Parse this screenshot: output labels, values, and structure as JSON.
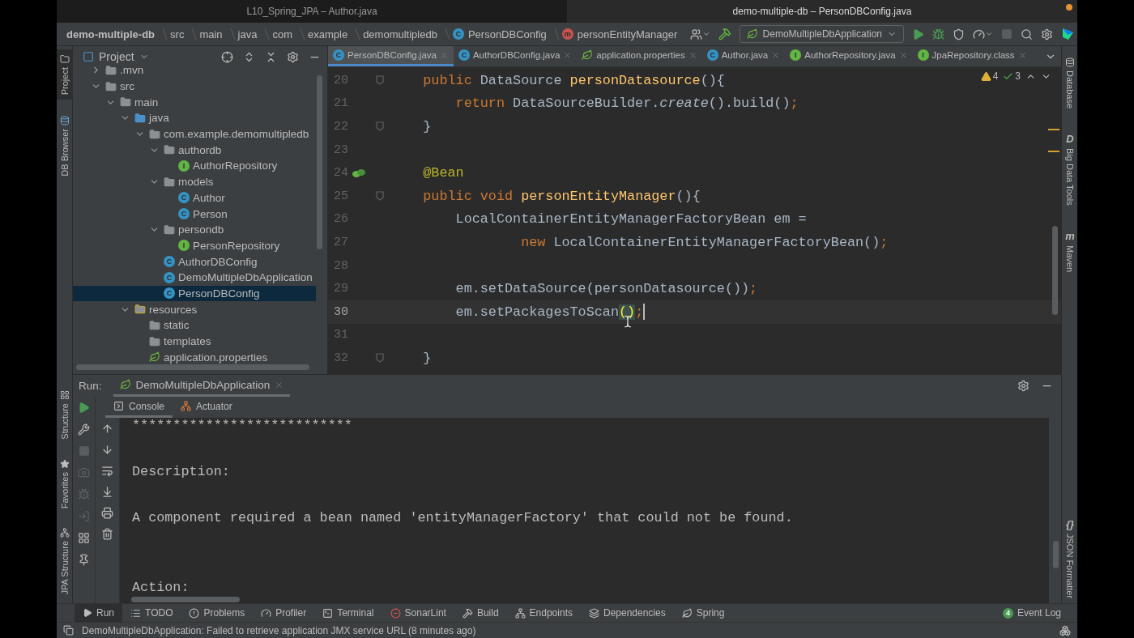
{
  "title_bar": {
    "left_title": "L10_Spring_JPA – Author.java",
    "right_title": "demo-multiple-db – PersonDBConfig.java"
  },
  "breadcrumbs": [
    {
      "label": "demo-multiple-db",
      "kind": "project"
    },
    {
      "label": "src",
      "kind": "folder"
    },
    {
      "label": "main",
      "kind": "folder"
    },
    {
      "label": "java",
      "kind": "folder"
    },
    {
      "label": "com",
      "kind": "folder"
    },
    {
      "label": "example",
      "kind": "folder"
    },
    {
      "label": "demomultipledb",
      "kind": "folder"
    },
    {
      "label": "PersonDBConfig",
      "kind": "class",
      "badge": "C"
    },
    {
      "label": "personEntityManager",
      "kind": "method",
      "badge": "m"
    }
  ],
  "run_configuration": "DemoMultipleDbApplication",
  "left_stripe_top": [
    {
      "label": "Project",
      "selected": true
    },
    {
      "label": "DB Browser",
      "selected": false
    }
  ],
  "left_stripe_bottom": [
    {
      "label": "Structure",
      "selected": false
    },
    {
      "label": "Favorites",
      "selected": false
    },
    {
      "label": "JPA Structure",
      "selected": false
    }
  ],
  "right_stripe_top": [
    {
      "label": "Database",
      "kind": "database"
    },
    {
      "label": "Big Data Tools",
      "kind": "glyph",
      "glyph": "D"
    },
    {
      "label": "Maven",
      "kind": "glyph",
      "glyph": "m"
    }
  ],
  "right_stripe_bottom": [
    {
      "label": "JSON Formatter",
      "kind": "glyph",
      "glyph": "{}"
    }
  ],
  "project_panel": {
    "title": "Project",
    "tree": [
      {
        "label": ".mvn",
        "kind": "folder",
        "expanded": false,
        "selected": false
      },
      {
        "label": "src",
        "kind": "folder",
        "expanded": true,
        "selected": false,
        "children": [
          {
            "label": "main",
            "kind": "folder",
            "expanded": true,
            "selected": false,
            "children": [
              {
                "label": "java",
                "kind": "source",
                "expanded": true,
                "selected": false,
                "children": [
                  {
                    "label": "com.example.demomultipledb",
                    "kind": "package",
                    "expanded": true,
                    "selected": false,
                    "children": [
                      {
                        "label": "authordb",
                        "kind": "package",
                        "expanded": true,
                        "selected": false,
                        "children": [
                          {
                            "label": "AuthorRepository",
                            "kind": "interface",
                            "badge": "I",
                            "selected": false
                          }
                        ]
                      },
                      {
                        "label": "models",
                        "kind": "package",
                        "expanded": true,
                        "selected": false,
                        "children": [
                          {
                            "label": "Author",
                            "kind": "class",
                            "badge": "C",
                            "selected": false
                          },
                          {
                            "label": "Person",
                            "kind": "class",
                            "badge": "C",
                            "selected": false
                          }
                        ]
                      },
                      {
                        "label": "persondb",
                        "kind": "package",
                        "expanded": true,
                        "selected": false,
                        "children": [
                          {
                            "label": "PersonRepository",
                            "kind": "interface",
                            "badge": "I",
                            "selected": false
                          }
                        ]
                      },
                      {
                        "label": "AuthorDBConfig",
                        "kind": "class",
                        "badge": "C",
                        "selected": false
                      },
                      {
                        "label": "DemoMultipleDbApplication",
                        "kind": "app",
                        "badge": "C",
                        "selected": false
                      },
                      {
                        "label": "PersonDBConfig",
                        "kind": "class",
                        "badge": "C",
                        "selected": true
                      }
                    ]
                  }
                ]
              },
              {
                "label": "resources",
                "kind": "resources",
                "expanded": true,
                "selected": false,
                "children": [
                  {
                    "label": "static",
                    "kind": "folder",
                    "selected": false
                  },
                  {
                    "label": "templates",
                    "kind": "folder",
                    "selected": false
                  },
                  {
                    "label": "application.properties",
                    "kind": "spring",
                    "selected": false
                  }
                ]
              }
            ]
          }
        ]
      }
    ]
  },
  "editor_tabs": [
    {
      "label": "PersonDBConfig.java",
      "kind": "class",
      "badge": "C",
      "selected": true
    },
    {
      "label": "AuthorDBConfig.java",
      "kind": "class",
      "badge": "C",
      "selected": false
    },
    {
      "label": "application.properties",
      "kind": "spring",
      "selected": false
    },
    {
      "label": "Author.java",
      "kind": "class",
      "badge": "C",
      "selected": false
    },
    {
      "label": "AuthorRepository.java",
      "kind": "interface",
      "badge": "I",
      "selected": false
    },
    {
      "label": "JpaRepository.class",
      "kind": "interface",
      "badge": "I",
      "selected": false
    }
  ],
  "inspections": {
    "warnings": "4",
    "weak_warnings": "3"
  },
  "code_lines": [
    {
      "number": "20",
      "kind": "fold",
      "current": false,
      "tokens": [
        {
          "text": "    public ",
          "kind": "keyword"
        },
        {
          "text": "DataSource ",
          "kind": "plain"
        },
        {
          "text": "personDatasource",
          "kind": "method"
        },
        {
          "text": "(){",
          "kind": "plain"
        }
      ]
    },
    {
      "number": "21",
      "kind": "plain",
      "current": false,
      "tokens": [
        {
          "text": "        return ",
          "kind": "keyword"
        },
        {
          "text": "DataSourceBuilder.",
          "kind": "plain"
        },
        {
          "text": "create",
          "kind": "static"
        },
        {
          "text": "().build()",
          "kind": "plain"
        },
        {
          "text": ";",
          "kind": "keyword"
        }
      ]
    },
    {
      "number": "22",
      "kind": "fold",
      "current": false,
      "tokens": [
        {
          "text": "    }",
          "kind": "plain"
        }
      ]
    },
    {
      "number": "23",
      "kind": "plain",
      "current": false
    },
    {
      "number": "24",
      "kind": "bean",
      "current": false,
      "tokens": [
        {
          "text": "    @Bean",
          "kind": "annotation"
        }
      ]
    },
    {
      "number": "25",
      "kind": "fold",
      "current": false,
      "tokens": [
        {
          "text": "    public void ",
          "kind": "keyword"
        },
        {
          "text": "personEntityManager",
          "kind": "method"
        },
        {
          "text": "(){",
          "kind": "plain"
        }
      ]
    },
    {
      "number": "26",
      "kind": "plain",
      "current": false,
      "tokens": [
        {
          "text": "        LocalContainerEntityManagerFactoryBean em =",
          "kind": "plain"
        }
      ]
    },
    {
      "number": "27",
      "kind": "plain",
      "current": false,
      "tokens": [
        {
          "text": "                new ",
          "kind": "keyword"
        },
        {
          "text": "LocalContainerEntityManagerFactoryBean()",
          "kind": "plain"
        },
        {
          "text": ";",
          "kind": "keyword"
        }
      ]
    },
    {
      "number": "28",
      "kind": "plain",
      "current": false
    },
    {
      "number": "29",
      "kind": "plain",
      "current": false,
      "tokens": [
        {
          "text": "        em.setDataSource(personDatasource())",
          "kind": "plain"
        },
        {
          "text": ";",
          "kind": "keyword"
        }
      ]
    },
    {
      "number": "30",
      "kind": "plain",
      "current": true,
      "tokens": [
        {
          "text": "        em.setPackagesToScan",
          "kind": "plain"
        },
        {
          "text": "()",
          "kind": "matched"
        },
        {
          "text": ";",
          "kind": "keyword"
        }
      ]
    },
    {
      "number": "31",
      "kind": "plain",
      "current": false
    },
    {
      "number": "32",
      "kind": "fold",
      "current": false,
      "tokens": [
        {
          "text": "    }",
          "kind": "plain"
        }
      ]
    }
  ],
  "run_panel": {
    "label": "Run:",
    "tab": "DemoMultipleDbApplication",
    "subtabs": [
      {
        "label": "Console",
        "kind": "console",
        "selected": true
      },
      {
        "label": "Actuator",
        "kind": "actuator",
        "selected": false
      }
    ],
    "console_output": "***************************\n\nDescription:\n\nA component required a bean named 'entityManagerFactory' that could not be found.\n\n\nAction:"
  },
  "bottom_tools": [
    {
      "label": "Run",
      "kind": "run",
      "selected": true
    },
    {
      "label": "TODO",
      "kind": "todo",
      "selected": false
    },
    {
      "label": "Problems",
      "kind": "problems",
      "selected": false
    },
    {
      "label": "Profiler",
      "kind": "profiler",
      "selected": false
    },
    {
      "label": "Terminal",
      "kind": "terminal",
      "selected": false
    },
    {
      "label": "SonarLint",
      "kind": "sonar",
      "selected": false
    },
    {
      "label": "Build",
      "kind": "build",
      "selected": false
    },
    {
      "label": "Endpoints",
      "kind": "endpoints",
      "selected": false
    },
    {
      "label": "Dependencies",
      "kind": "dependencies",
      "selected": false
    },
    {
      "label": "Spring",
      "kind": "spring",
      "selected": false
    }
  ],
  "event_log": {
    "label": "Event Log",
    "count": "4"
  },
  "status_bar": "DemoMultipleDbApplication: Failed to retrieve application JMX service URL (8 minutes ago)"
}
